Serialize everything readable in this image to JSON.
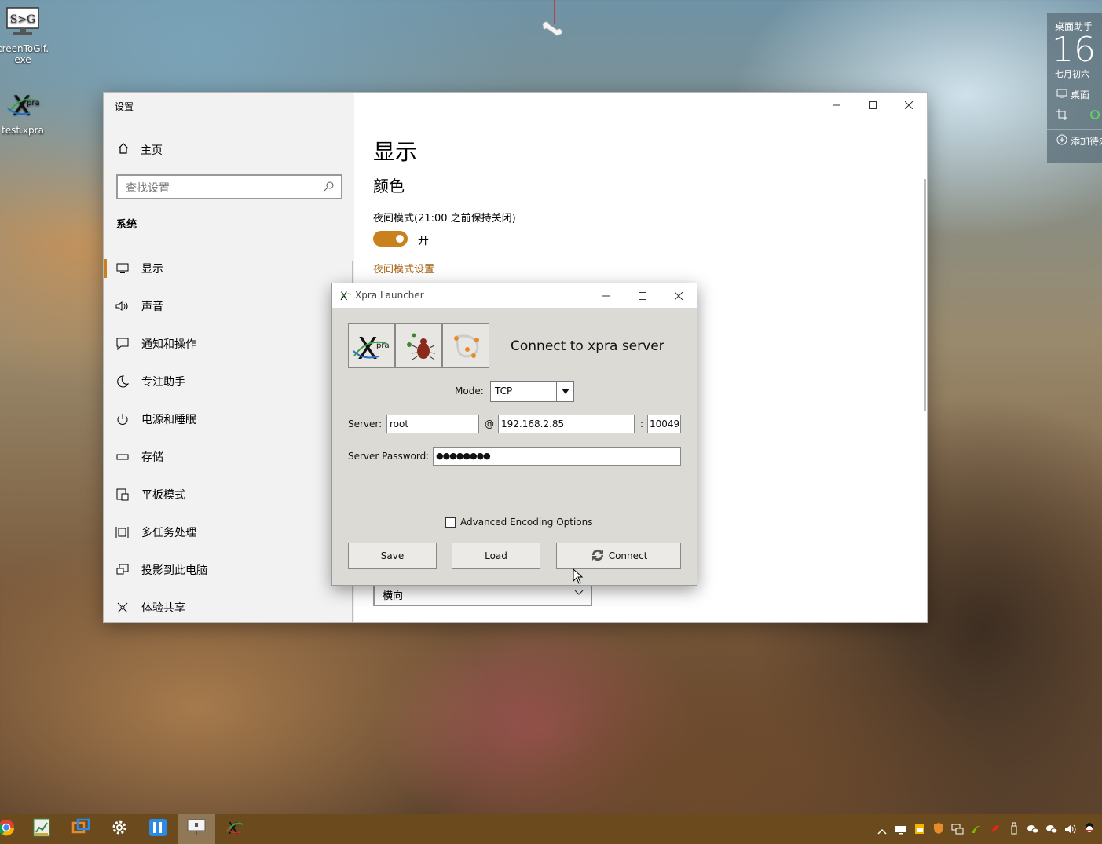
{
  "desktop": {
    "icons": [
      {
        "label": "creenToGif.exe",
        "icon": "screentogif-icon"
      },
      {
        "label": "test.xpra",
        "icon": "xpra-icon"
      }
    ],
    "widget": {
      "title": "桌面助手",
      "day": "16",
      "lunar": "七月初六",
      "desktop_label": "桌面",
      "add_label": "添加待办"
    }
  },
  "settings": {
    "window_title": "设置",
    "home_label": "主页",
    "search_placeholder": "查找设置",
    "section_title": "系统",
    "nav": [
      {
        "label": "显示",
        "icon": "monitor-icon",
        "active": true
      },
      {
        "label": "声音",
        "icon": "speaker-icon"
      },
      {
        "label": "通知和操作",
        "icon": "notification-icon"
      },
      {
        "label": "专注助手",
        "icon": "moon-icon"
      },
      {
        "label": "电源和睡眠",
        "icon": "power-icon"
      },
      {
        "label": "存储",
        "icon": "storage-icon"
      },
      {
        "label": "平板模式",
        "icon": "tablet-icon"
      },
      {
        "label": "多任务处理",
        "icon": "multitask-icon"
      },
      {
        "label": "投影到此电脑",
        "icon": "project-icon"
      },
      {
        "label": "体验共享",
        "icon": "share-icon"
      }
    ],
    "content": {
      "title": "显示",
      "section": "颜色",
      "night_mode_label": "夜间模式(21:00 之前保持关闭)",
      "toggle_state": "开",
      "toggle_on": true,
      "night_mode_link": "夜间模式设置",
      "orientation_value": "横向"
    },
    "accent_color": "#c8811c"
  },
  "xpra": {
    "window_title": "Xpra Launcher",
    "heading": "Connect to xpra server",
    "mode_label": "Mode:",
    "mode_value": "TCP",
    "server_label": "Server:",
    "username": "root",
    "at": "@",
    "host": "192.168.2.85",
    "colon": ":",
    "port": "10049",
    "password_label": "Server Password:",
    "password_mask": "●●●●●●●●",
    "advanced_label": "Advanced Encoding Options",
    "advanced_checked": false,
    "save_label": "Save",
    "load_label": "Load",
    "connect_label": "Connect"
  },
  "taskbar": {
    "apps": [
      "chrome-icon",
      "spreadsheet-icon",
      "remote-desktop-icon",
      "settings-gear-icon",
      "lofter-icon",
      "presentation-icon",
      "xpra-icon"
    ],
    "tray": [
      "chevron-up-icon",
      "keyboard-icon",
      "calendar-icon",
      "shield-icon",
      "network-icon",
      "nvidia-icon",
      "antivirus-icon",
      "usb-icon",
      "wechat-icon",
      "wechat-icon-2",
      "volume-icon",
      "qq-icon"
    ]
  }
}
